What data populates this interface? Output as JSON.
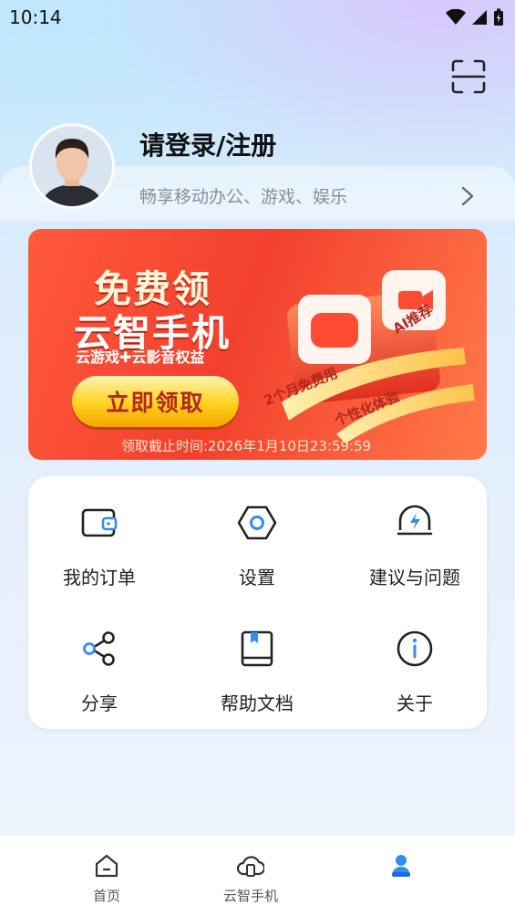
{
  "status_bar": {
    "time": "10:14"
  },
  "header": {
    "login_title": "请登录/注册",
    "login_subtitle": "畅享移动办公、游戏、娱乐"
  },
  "banner": {
    "title_line1": "免费领",
    "title_line2": "云智手机",
    "subtitle": "云游戏✚云影音权益",
    "cta": "立即领取",
    "deadline": "领取截止时间:2026年1月10日23:59:59",
    "tags": {
      "ai": "AI推荐",
      "months": "2个月免费用",
      "personal": "个性化体验"
    }
  },
  "menu": {
    "items": [
      {
        "label": "我的订单",
        "icon": "wallet-icon"
      },
      {
        "label": "设置",
        "icon": "settings-hex-icon"
      },
      {
        "label": "建议与问题",
        "icon": "feedback-bolt-icon"
      },
      {
        "label": "分享",
        "icon": "share-icon"
      },
      {
        "label": "帮助文档",
        "icon": "book-icon"
      },
      {
        "label": "关于",
        "icon": "info-icon"
      }
    ]
  },
  "bottom_nav": {
    "items": [
      {
        "label": "首页",
        "icon": "home-icon"
      },
      {
        "label": "云智手机",
        "icon": "cloud-phone-icon"
      },
      {
        "label": "",
        "icon": "profile-icon",
        "active": true
      }
    ]
  },
  "colors": {
    "accent": "#2f8ff0",
    "banner_red": "#f2402d",
    "cta_yellow": "#ffd21f"
  }
}
